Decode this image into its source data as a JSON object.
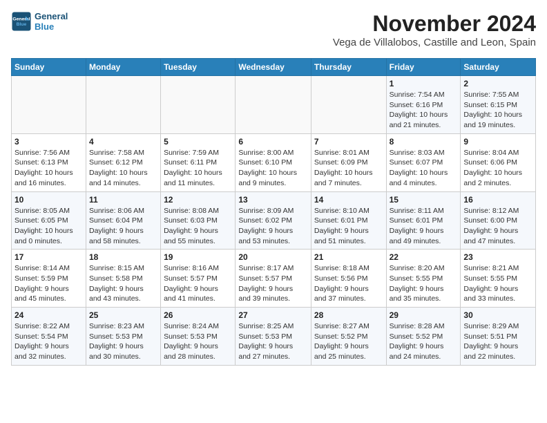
{
  "header": {
    "logo_general": "General",
    "logo_blue": "Blue",
    "month_title": "November 2024",
    "location": "Vega de Villalobos, Castille and Leon, Spain"
  },
  "days_of_week": [
    "Sunday",
    "Monday",
    "Tuesday",
    "Wednesday",
    "Thursday",
    "Friday",
    "Saturday"
  ],
  "weeks": [
    [
      {
        "day": "",
        "info": ""
      },
      {
        "day": "",
        "info": ""
      },
      {
        "day": "",
        "info": ""
      },
      {
        "day": "",
        "info": ""
      },
      {
        "day": "",
        "info": ""
      },
      {
        "day": "1",
        "info": "Sunrise: 7:54 AM\nSunset: 6:16 PM\nDaylight: 10 hours\nand 21 minutes."
      },
      {
        "day": "2",
        "info": "Sunrise: 7:55 AM\nSunset: 6:15 PM\nDaylight: 10 hours\nand 19 minutes."
      }
    ],
    [
      {
        "day": "3",
        "info": "Sunrise: 7:56 AM\nSunset: 6:13 PM\nDaylight: 10 hours\nand 16 minutes."
      },
      {
        "day": "4",
        "info": "Sunrise: 7:58 AM\nSunset: 6:12 PM\nDaylight: 10 hours\nand 14 minutes."
      },
      {
        "day": "5",
        "info": "Sunrise: 7:59 AM\nSunset: 6:11 PM\nDaylight: 10 hours\nand 11 minutes."
      },
      {
        "day": "6",
        "info": "Sunrise: 8:00 AM\nSunset: 6:10 PM\nDaylight: 10 hours\nand 9 minutes."
      },
      {
        "day": "7",
        "info": "Sunrise: 8:01 AM\nSunset: 6:09 PM\nDaylight: 10 hours\nand 7 minutes."
      },
      {
        "day": "8",
        "info": "Sunrise: 8:03 AM\nSunset: 6:07 PM\nDaylight: 10 hours\nand 4 minutes."
      },
      {
        "day": "9",
        "info": "Sunrise: 8:04 AM\nSunset: 6:06 PM\nDaylight: 10 hours\nand 2 minutes."
      }
    ],
    [
      {
        "day": "10",
        "info": "Sunrise: 8:05 AM\nSunset: 6:05 PM\nDaylight: 10 hours\nand 0 minutes."
      },
      {
        "day": "11",
        "info": "Sunrise: 8:06 AM\nSunset: 6:04 PM\nDaylight: 9 hours\nand 58 minutes."
      },
      {
        "day": "12",
        "info": "Sunrise: 8:08 AM\nSunset: 6:03 PM\nDaylight: 9 hours\nand 55 minutes."
      },
      {
        "day": "13",
        "info": "Sunrise: 8:09 AM\nSunset: 6:02 PM\nDaylight: 9 hours\nand 53 minutes."
      },
      {
        "day": "14",
        "info": "Sunrise: 8:10 AM\nSunset: 6:01 PM\nDaylight: 9 hours\nand 51 minutes."
      },
      {
        "day": "15",
        "info": "Sunrise: 8:11 AM\nSunset: 6:01 PM\nDaylight: 9 hours\nand 49 minutes."
      },
      {
        "day": "16",
        "info": "Sunrise: 8:12 AM\nSunset: 6:00 PM\nDaylight: 9 hours\nand 47 minutes."
      }
    ],
    [
      {
        "day": "17",
        "info": "Sunrise: 8:14 AM\nSunset: 5:59 PM\nDaylight: 9 hours\nand 45 minutes."
      },
      {
        "day": "18",
        "info": "Sunrise: 8:15 AM\nSunset: 5:58 PM\nDaylight: 9 hours\nand 43 minutes."
      },
      {
        "day": "19",
        "info": "Sunrise: 8:16 AM\nSunset: 5:57 PM\nDaylight: 9 hours\nand 41 minutes."
      },
      {
        "day": "20",
        "info": "Sunrise: 8:17 AM\nSunset: 5:57 PM\nDaylight: 9 hours\nand 39 minutes."
      },
      {
        "day": "21",
        "info": "Sunrise: 8:18 AM\nSunset: 5:56 PM\nDaylight: 9 hours\nand 37 minutes."
      },
      {
        "day": "22",
        "info": "Sunrise: 8:20 AM\nSunset: 5:55 PM\nDaylight: 9 hours\nand 35 minutes."
      },
      {
        "day": "23",
        "info": "Sunrise: 8:21 AM\nSunset: 5:55 PM\nDaylight: 9 hours\nand 33 minutes."
      }
    ],
    [
      {
        "day": "24",
        "info": "Sunrise: 8:22 AM\nSunset: 5:54 PM\nDaylight: 9 hours\nand 32 minutes."
      },
      {
        "day": "25",
        "info": "Sunrise: 8:23 AM\nSunset: 5:53 PM\nDaylight: 9 hours\nand 30 minutes."
      },
      {
        "day": "26",
        "info": "Sunrise: 8:24 AM\nSunset: 5:53 PM\nDaylight: 9 hours\nand 28 minutes."
      },
      {
        "day": "27",
        "info": "Sunrise: 8:25 AM\nSunset: 5:53 PM\nDaylight: 9 hours\nand 27 minutes."
      },
      {
        "day": "28",
        "info": "Sunrise: 8:27 AM\nSunset: 5:52 PM\nDaylight: 9 hours\nand 25 minutes."
      },
      {
        "day": "29",
        "info": "Sunrise: 8:28 AM\nSunset: 5:52 PM\nDaylight: 9 hours\nand 24 minutes."
      },
      {
        "day": "30",
        "info": "Sunrise: 8:29 AM\nSunset: 5:51 PM\nDaylight: 9 hours\nand 22 minutes."
      }
    ]
  ]
}
